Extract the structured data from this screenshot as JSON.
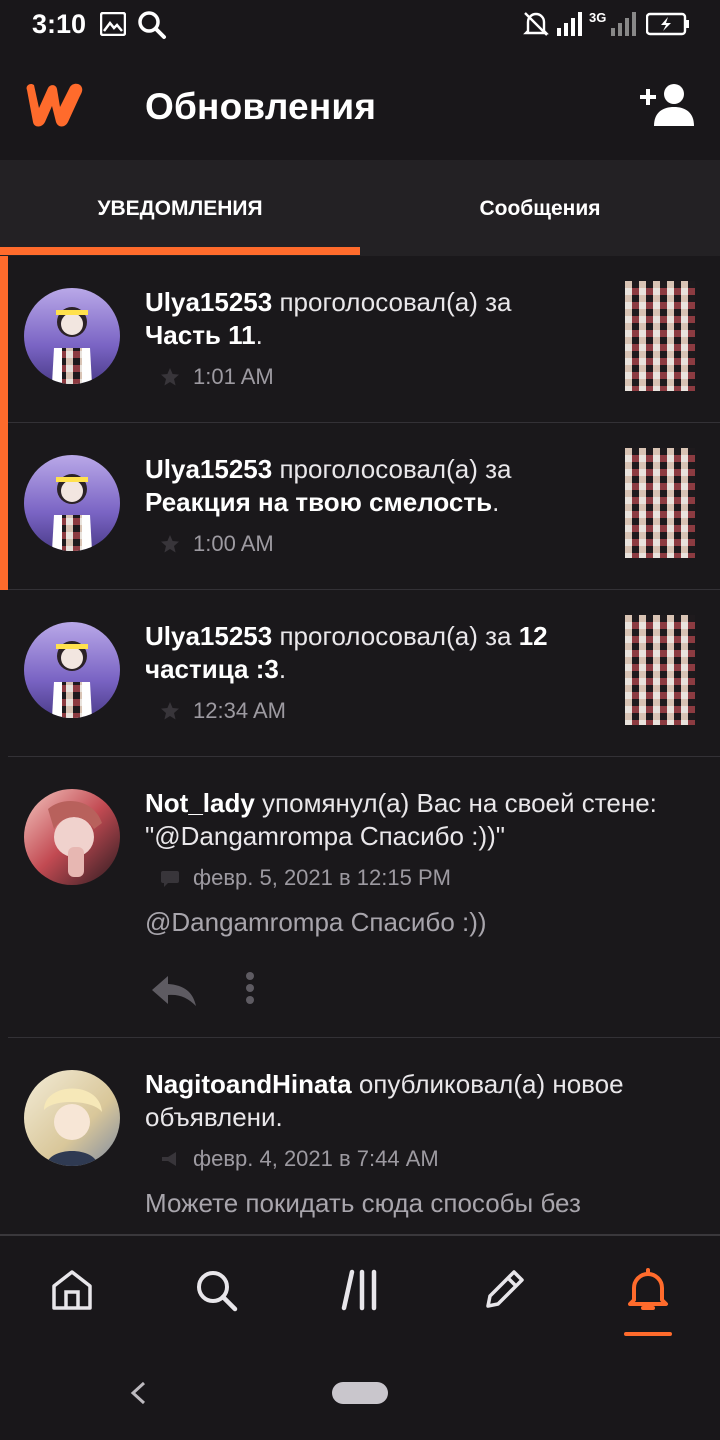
{
  "status_bar": {
    "time": "3:10",
    "network": "3G"
  },
  "app_bar": {
    "title": "Обновления"
  },
  "tabs": [
    {
      "label": "УВЕДОМЛЕНИЯ",
      "active": true
    },
    {
      "label": "Сообщения",
      "active": false
    }
  ],
  "notifications": [
    {
      "user": "Ulya15253",
      "action": "проголосовал(а) за",
      "target": "Часть 11",
      "end": ".",
      "time": "1:01 AM",
      "unread": true
    },
    {
      "user": "Ulya15253",
      "action": "проголосовал(а) за",
      "target": "Реакция на твою смелость",
      "end": ".",
      "time": "1:00 AM",
      "unread": true
    },
    {
      "user": "Ulya15253",
      "action": "проголосовал(а) за",
      "target": "12 частица :3",
      "end": ".",
      "time": "12:34 AM",
      "unread": false
    },
    {
      "user": "Not_lady",
      "action": "упомянул(а) Вас на своей стене:",
      "quote_line": "\"@Dangamrompa Спасибо :))\"",
      "time": "февр. 5, 2021 в 12:15 PM",
      "message": "@Dangamrompa  Спасибо :))"
    },
    {
      "user": "NagitoandHinata",
      "action": "опубликовал(а) новое",
      "action_line2": "объявлени.",
      "time": "февр. 4, 2021 в 7:44 AM",
      "message": "Можете покидать сюда способы без"
    }
  ],
  "colors": {
    "accent": "#ff6b2c",
    "background": "#1a181b",
    "surface": "#232124"
  },
  "bottom_nav": [
    "home-icon",
    "search-icon",
    "library-icon",
    "write-icon",
    "notifications-icon"
  ],
  "active_nav": "notifications-icon"
}
